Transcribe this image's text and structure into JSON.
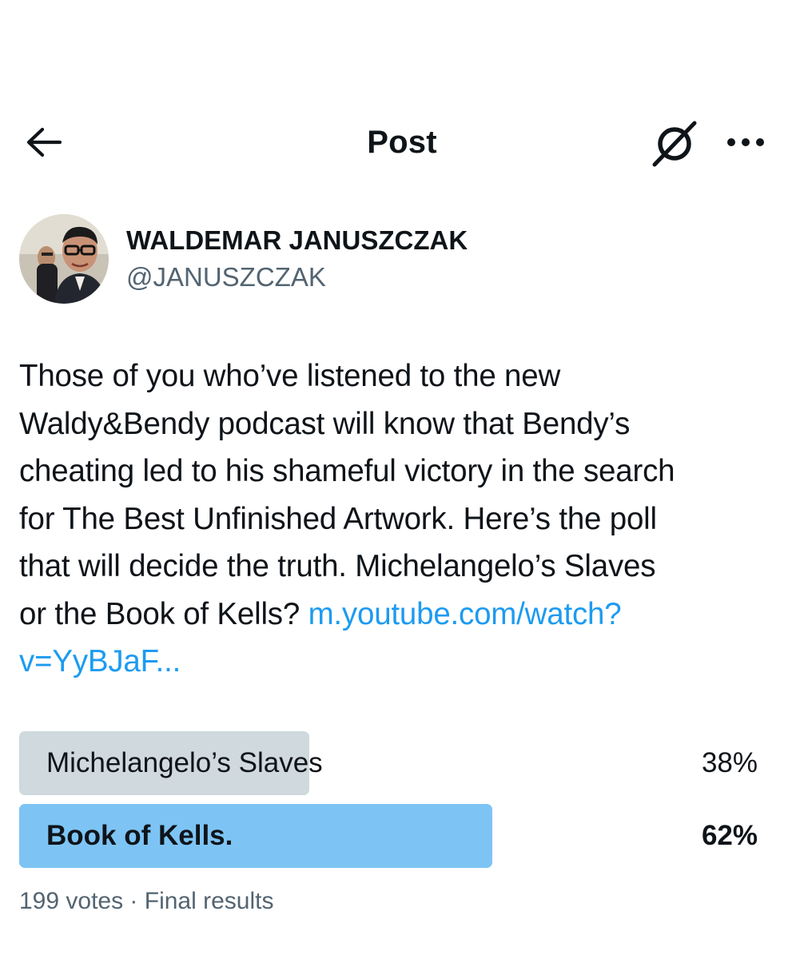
{
  "header": {
    "title": "Post",
    "back_icon": "arrow-left-icon",
    "grok_icon": "grok-icon",
    "more_icon": "more-horizontal-icon"
  },
  "author": {
    "name": "WALDEMAR JANUSZCZAK",
    "handle": "@JANUSZCZAK"
  },
  "post": {
    "lines": [
      "Those of you who’ve listened to the new",
      "Waldy&Bendy podcast will know that Bendy’s",
      "cheating led to his shameful victory in the search",
      "for The Best Unfinished Artwork. Here’s the poll",
      "that will decide the truth. Michelangelo’s Slaves"
    ],
    "last_line_text": "or the Book of Kells? ",
    "link_part1": "m.youtube.com/watch?",
    "link_part2": "v=YyBJaF..."
  },
  "poll": {
    "options": [
      {
        "label": "Michelangelo’s Slaves",
        "percent_text": "38%",
        "percent": 38,
        "winner": false
      },
      {
        "label": "Book of Kells.",
        "percent_text": "62%",
        "percent": 62,
        "winner": true
      }
    ],
    "meta": "199 votes · Final results"
  },
  "colors": {
    "text": "#0f1419",
    "secondary": "#536471",
    "link": "#1d9bf0",
    "poll_bar": "#cfd9de",
    "poll_bar_winner": "#7dc4f5"
  }
}
